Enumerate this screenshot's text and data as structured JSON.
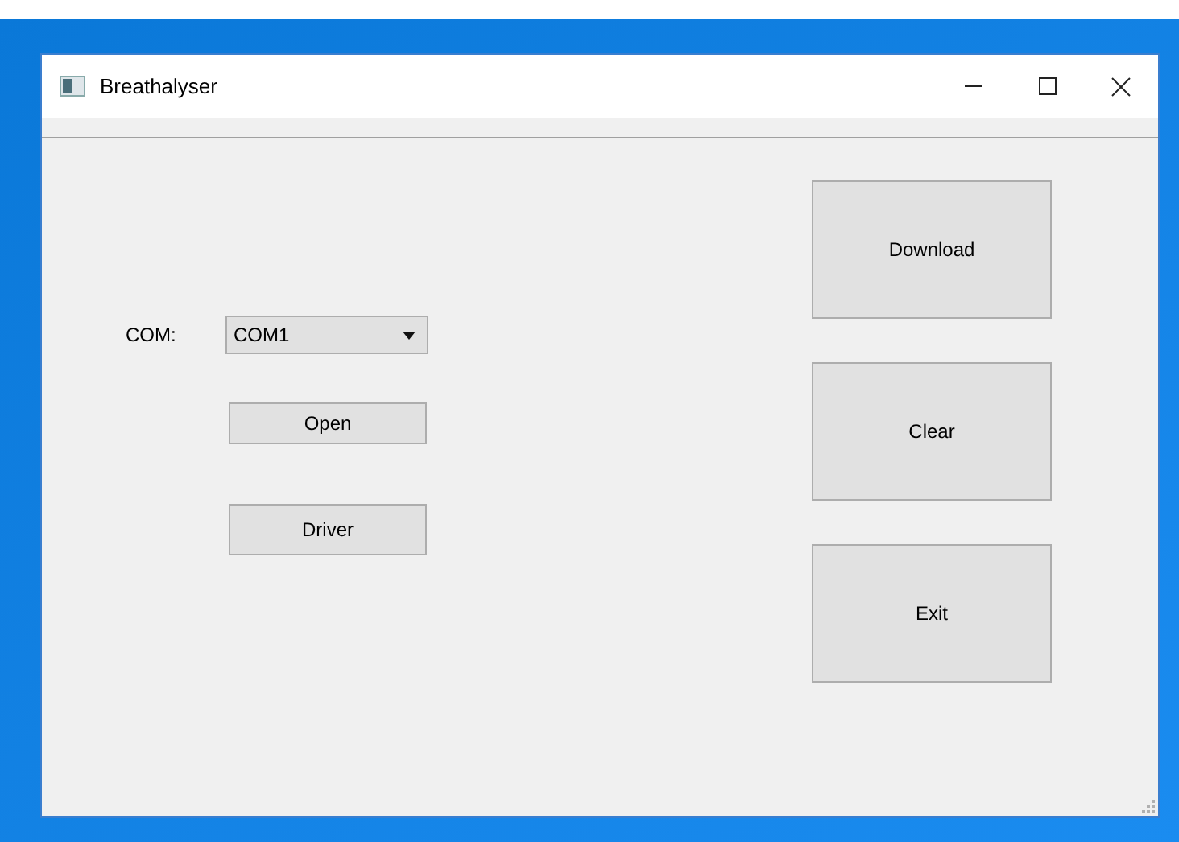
{
  "window": {
    "title": "Breathalyser"
  },
  "port": {
    "label": "COM:",
    "value": "COM1"
  },
  "left_buttons": [
    "Open",
    "Driver"
  ],
  "right_buttons": [
    "Download",
    "Clear",
    "Exit"
  ]
}
